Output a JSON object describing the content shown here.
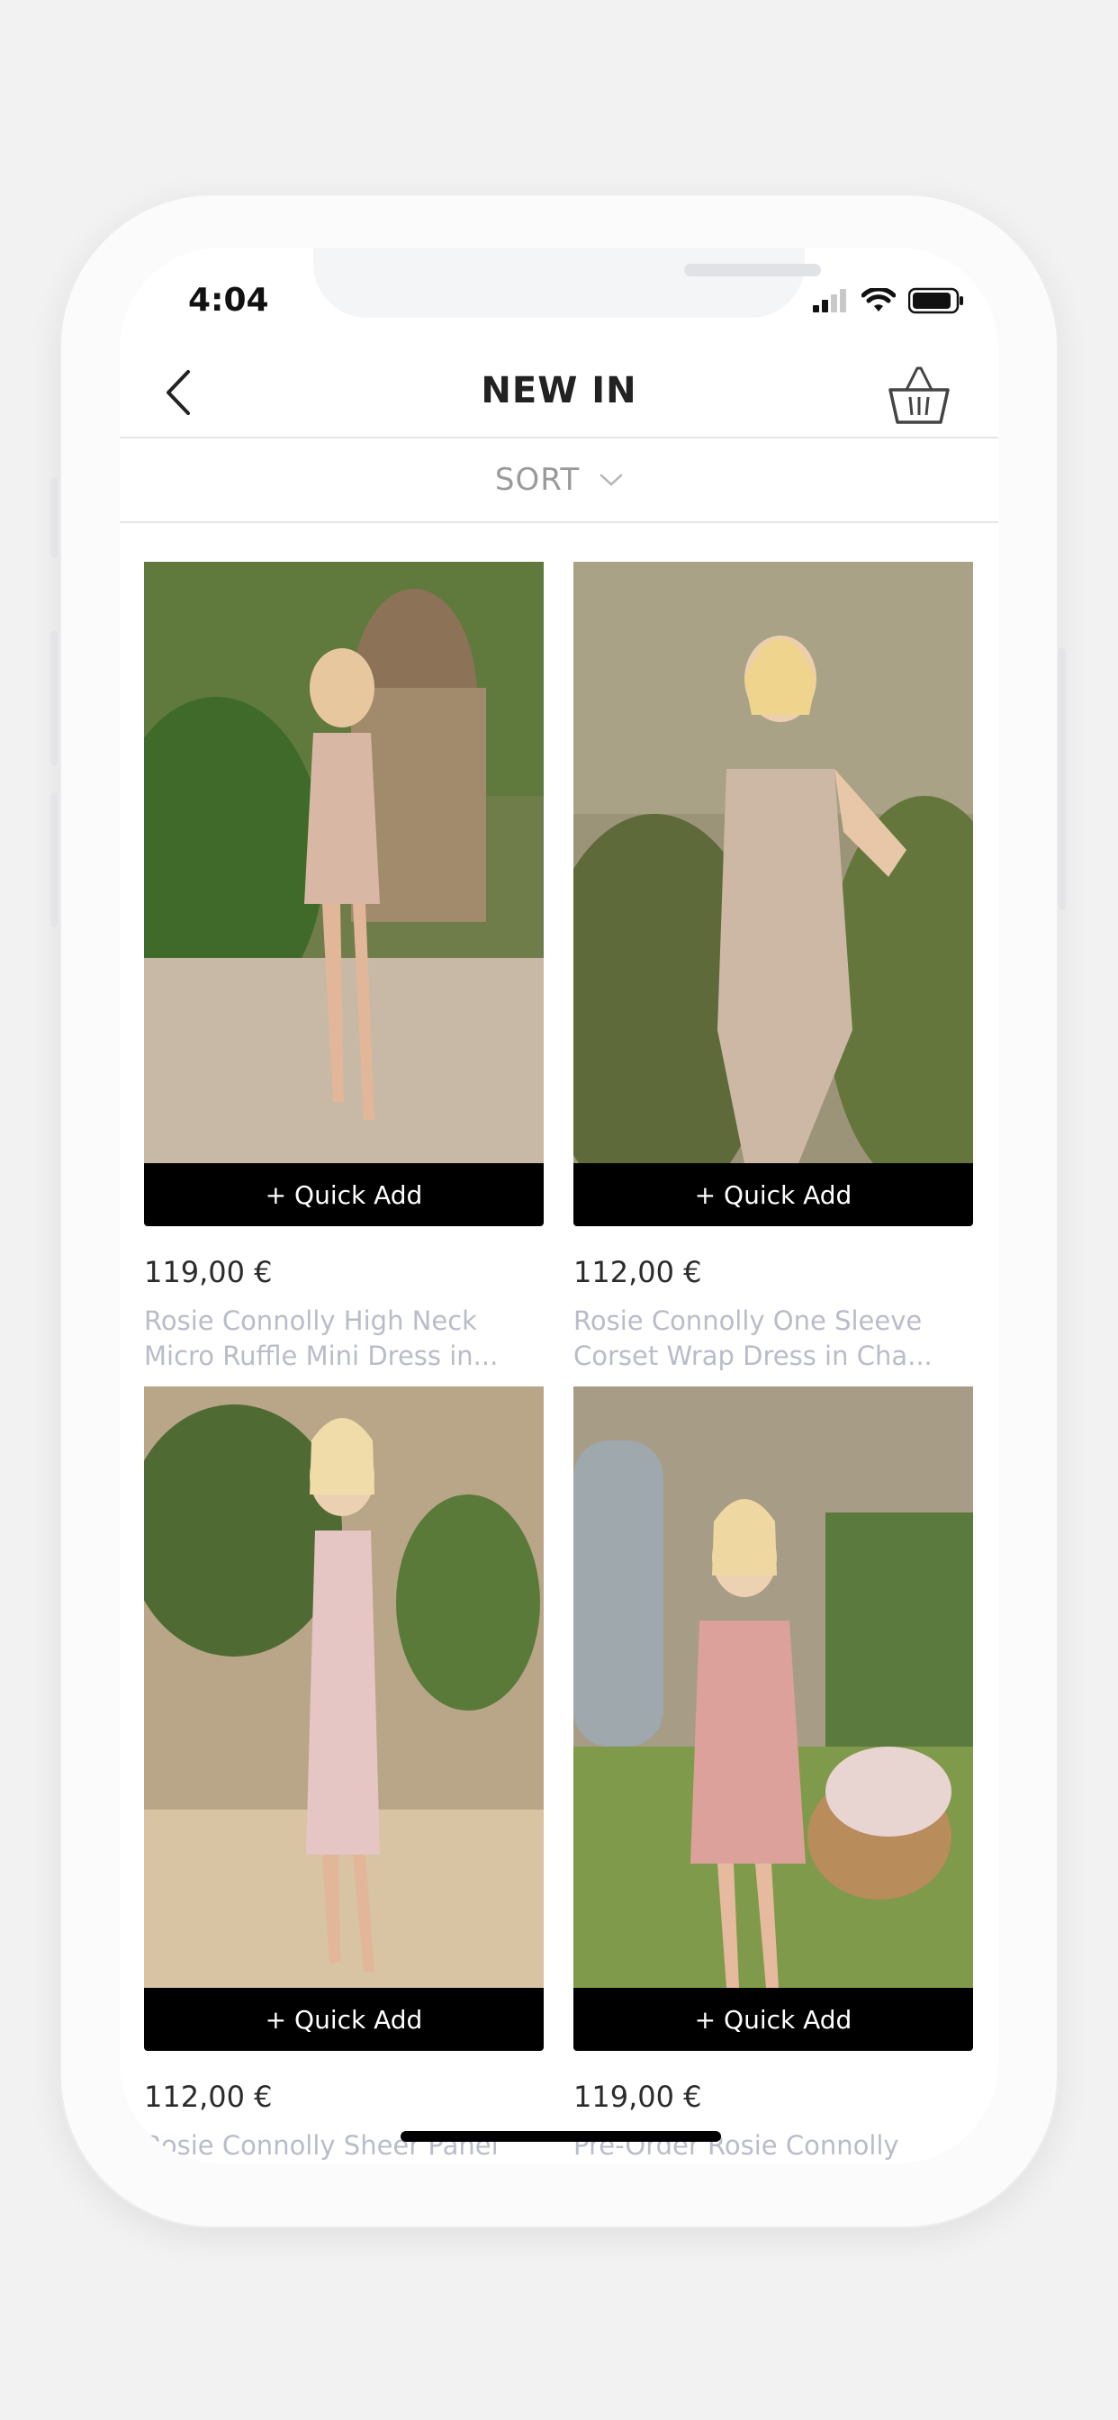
{
  "status": {
    "time": "4:04"
  },
  "header": {
    "title": "NEW IN"
  },
  "sort": {
    "label": "SORT"
  },
  "products": [
    {
      "price": "119,00 €",
      "name": "Rosie Connolly High Neck Micro Ruffle Mini Dress in...",
      "quick_add": "+ Quick Add"
    },
    {
      "price": "112,00 €",
      "name": "Rosie Connolly One Sleeve Corset Wrap Dress in Cha...",
      "quick_add": "+ Quick Add"
    },
    {
      "price": "112,00 €",
      "name": "Rosie Connolly Sheer Panel",
      "quick_add": "+ Quick Add"
    },
    {
      "price": "119,00 €",
      "name": "Pre-Order Rosie Connolly",
      "quick_add": "+ Quick Add"
    }
  ],
  "icons": {
    "back": "chevron-left-icon",
    "cart": "basket-icon",
    "sort": "chevron-down-icon"
  }
}
